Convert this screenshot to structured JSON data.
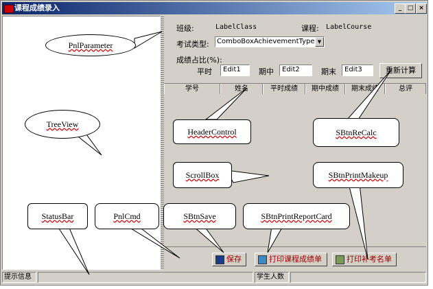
{
  "window": {
    "title": "课程成绩录入",
    "min_label": "_",
    "max_label": "□",
    "close_label": "×"
  },
  "params": {
    "class_label": "班级:",
    "class_value": "LabelClass",
    "course_label": "课程:",
    "course_value": "LabelCourse",
    "exam_type_label": "考试类型:",
    "exam_type_value": "ComboBoxAchievementType",
    "ratio_label": "成绩占比(%):",
    "regular_label": "平时",
    "regular_value": "Edit1",
    "midterm_label": "期中",
    "midterm_value": "Edit2",
    "final_label": "期末",
    "final_value": "Edit3",
    "recalc_label": "重新计算"
  },
  "header_columns": [
    "学号",
    "姓名",
    "平时成绩",
    "期中成绩",
    "期末成绩",
    "总评"
  ],
  "commands": {
    "save": "保存",
    "print_report": "打印课程成绩单",
    "print_makeup": "打印补考名单"
  },
  "status": {
    "hint": "提示信息",
    "students": "学生人数"
  },
  "callouts": {
    "pnl_parameter": "PnlParameter",
    "tree_view": "TreeView",
    "header_control": "HeaderControl",
    "sbtn_recalc": "SBtnReCalc",
    "scroll_box": "ScrollBox",
    "sbtn_print_makeup": "SBtnPrintMakeup",
    "status_bar": "StatusBar",
    "pnl_cmd": "PnlCmd",
    "sbtn_save": "SBtnSave",
    "sbtn_print_report": "SBtnPrintReportCard"
  }
}
